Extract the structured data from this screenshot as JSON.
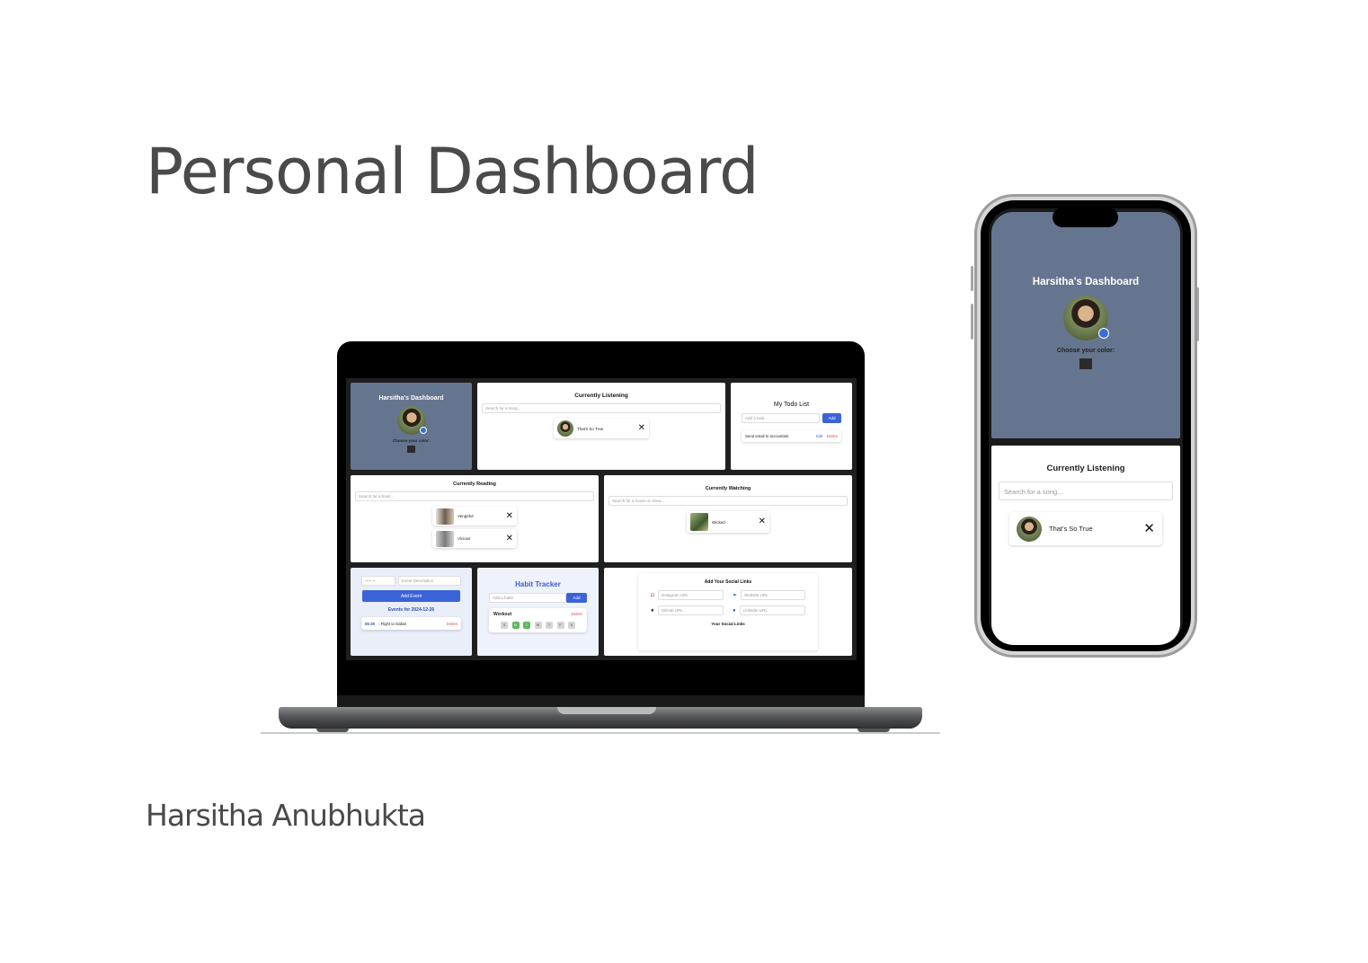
{
  "page": {
    "title": "Personal Dashboard",
    "author": "Harsitha Anubhukta"
  },
  "dashboard": {
    "heading": "Harsitha's Dashboard",
    "choose_color_label": "Choose your color:",
    "accent_color": "#66758f",
    "swatch_color": "#2b2b2b"
  },
  "listening": {
    "title": "Currently Listening",
    "search_placeholder": "Search for a song...",
    "items": [
      {
        "name": "That's So True"
      }
    ]
  },
  "todo": {
    "title": "My Todo List",
    "input_placeholder": "Add a task...",
    "add_label": "Add",
    "items": [
      {
        "text": "Send email to accountant",
        "edit": "Edit",
        "delete": "Delete"
      }
    ]
  },
  "reading": {
    "title": "Currently Reading",
    "search_placeholder": "Search for a book...",
    "items": [
      {
        "name": "Vengeful"
      },
      {
        "name": "Vicious"
      }
    ]
  },
  "watching": {
    "title": "Currently Watching",
    "search_placeholder": "Search for a movie or show...",
    "items": [
      {
        "name": "Wicked"
      }
    ]
  },
  "events": {
    "time_value": "--:-- --",
    "description_placeholder": "Event Description",
    "add_label": "Add Event",
    "heading": "Events for 2024-12-26",
    "items": [
      {
        "time": "06:30",
        "text": "- Flight to Dallas",
        "delete": "Delete"
      }
    ]
  },
  "habits": {
    "title": "Habit Tracker",
    "input_placeholder": "Add a habit",
    "add_label": "Add",
    "items": [
      {
        "name": "Workout",
        "delete": "Delete",
        "days": [
          "S",
          "M",
          "T",
          "W",
          "T",
          "F",
          "S"
        ],
        "done": [
          false,
          true,
          true,
          false,
          false,
          false,
          false
        ]
      }
    ]
  },
  "social": {
    "title": "Add Your Social Links",
    "instagram_placeholder": "Instagram URL",
    "website_placeholder": "Website URL",
    "github_placeholder": "GitHub URL",
    "linkedin_placeholder": "LinkedIn URL",
    "footer": "Your Social Links"
  }
}
